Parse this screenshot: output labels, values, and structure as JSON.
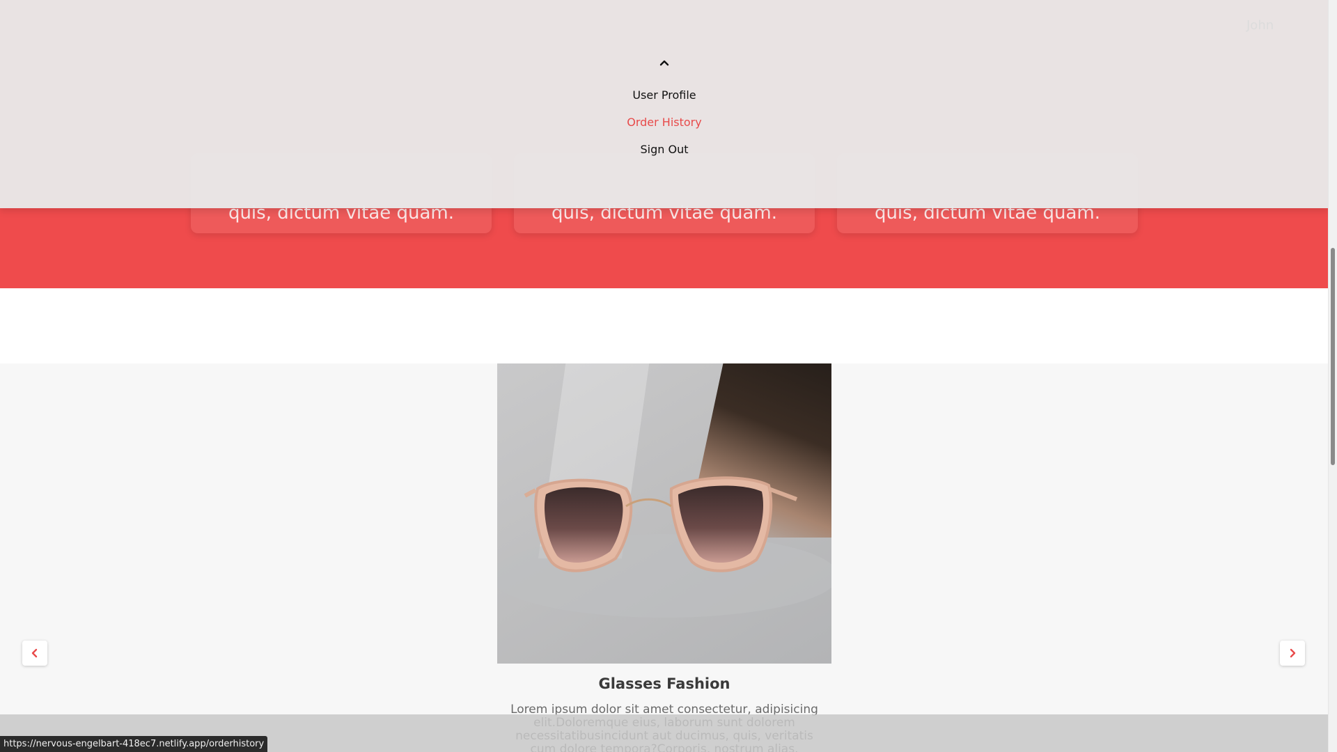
{
  "header": {
    "brand": "",
    "user_name": "John"
  },
  "dropdown": {
    "items": [
      {
        "label": "User Profile"
      },
      {
        "label": "Order History"
      },
      {
        "label": "Sign Out"
      }
    ],
    "active_color": "#e84a4a"
  },
  "features": {
    "cards": [
      {
        "text": "quis, dictum vitae quam."
      },
      {
        "text": "quis, dictum vitae quam."
      },
      {
        "text": "quis, dictum vitae quam."
      }
    ],
    "background_color": "#ef4b4c"
  },
  "carousel": {
    "slide": {
      "image_icon": "sunglasses-image",
      "title": "Glasses Fashion",
      "description": "Lorem ipsum dolor sit amet consectetur, adipisicing elit.Doloremque eius, laborum sunt dolorem necessitatibusincidunt aut ducimus, quis, veritatis cum dolore tempora?Corporis, nostrum alias."
    },
    "prev_icon": "chevron-left-icon",
    "next_icon": "chevron-right-icon",
    "accent_color": "#e84a4a"
  },
  "status_bar": {
    "url": "https://nervous-engelbart-418ec7.netlify.app/orderhistory"
  }
}
